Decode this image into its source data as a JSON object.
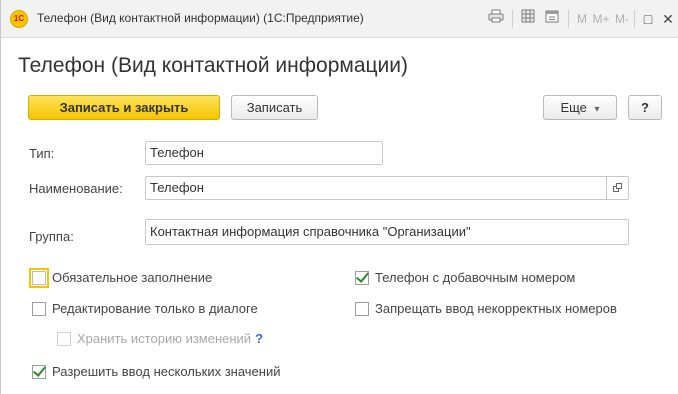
{
  "window": {
    "logo_text": "1С",
    "title": "Телефон (Вид контактной информации) (1С:Предприятие)",
    "toolbar": {
      "printer_icon": "printer-icon",
      "table_icon": "table-icon",
      "calendar_icon": "calendar-icon",
      "m": "M",
      "m_plus": "M+",
      "m_minus": "M-",
      "maximize_icon": "□",
      "close_icon": "✕"
    }
  },
  "page": {
    "title": "Телефон (Вид контактной информации)"
  },
  "actions": {
    "save_close": "Записать и закрыть",
    "save": "Записать",
    "more": "Еще",
    "more_arrow": "▾",
    "help": "?"
  },
  "fields": {
    "type_label": "Тип:",
    "type_value": "Телефон",
    "name_label": "Наименование:",
    "name_value": "Телефон",
    "group_label": "Группа:",
    "group_value": "Контактная информация справочника \"Организации\""
  },
  "checkboxes": {
    "required": {
      "label": "Обязательное заполнение",
      "checked": false
    },
    "with_extension": {
      "label": "Телефон с добавочным номером",
      "checked": true
    },
    "dialog_only": {
      "label": "Редактирование только в диалоге",
      "checked": false
    },
    "forbid_invalid": {
      "label": "Запрещать ввод некорректных номеров",
      "checked": false
    },
    "store_history": {
      "label": "Хранить историю изменений",
      "help": "?",
      "checked": false,
      "disabled": true
    },
    "allow_multiple": {
      "label": "Разрешить ввод нескольких значений",
      "checked": true
    }
  },
  "colors": {
    "primary_button": "#f4c500",
    "check_mark": "#2e8b2e",
    "help_link": "#2f6fd3"
  }
}
